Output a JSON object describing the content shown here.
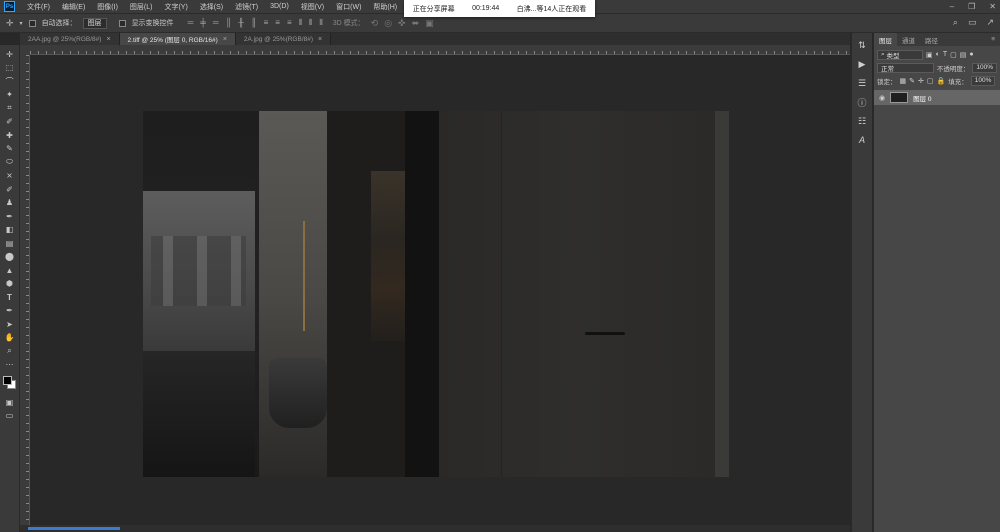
{
  "app": {
    "logo_text": "Ps"
  },
  "menu": [
    "文件(F)",
    "编辑(E)",
    "图像(I)",
    "图层(L)",
    "文字(Y)",
    "选择(S)",
    "滤镜(T)",
    "3D(D)",
    "视图(V)",
    "窗口(W)",
    "帮助(H)"
  ],
  "screen_share": {
    "status": "正在分享屏幕",
    "timer": "00:19:44",
    "viewers": "白沸...等14人正在观看"
  },
  "options_bar": {
    "auto_select_label": "自动选择：",
    "auto_select_value": "图层",
    "show_transform_label": "显示变换控件",
    "mode_3d_label": "3D 模式："
  },
  "doc_tabs": [
    {
      "label": "2AA.jpg @ 25%(RGB/8#)",
      "active": false
    },
    {
      "label": "2.tiff @ 25% (图层 0, RGB/16#)",
      "active": true
    },
    {
      "label": "2A.jpg @ 25%(RGB/8#)",
      "active": false
    }
  ],
  "layers_panel": {
    "tabs": [
      "图层",
      "通道",
      "路径"
    ],
    "filter_kind": "类型",
    "blend_mode": "正常",
    "opacity_label": "不透明度：",
    "opacity_value": "100%",
    "lock_label": "锁定：",
    "fill_label": "填充：",
    "fill_value": "100%",
    "layers": [
      {
        "name": "图层 0",
        "visible": true
      }
    ]
  },
  "colors": {
    "foreground": "#000000",
    "background": "#ffffff",
    "accent": "#3a7bd5"
  }
}
